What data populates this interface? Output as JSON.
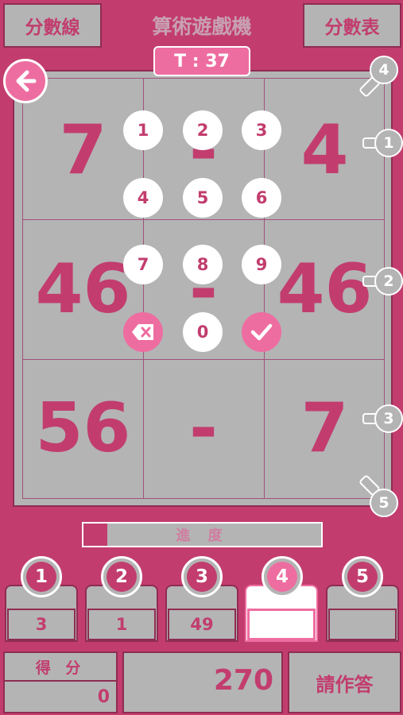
{
  "header": {
    "left_button": "分數線",
    "title": "算術遊戲機",
    "right_button": "分數表"
  },
  "timer": "T : 37",
  "grid": {
    "rows": [
      {
        "left": "7",
        "op": "-",
        "right": "4"
      },
      {
        "left": "46",
        "op": "-",
        "right": "46"
      },
      {
        "left": "56",
        "op": "-",
        "right": "7"
      }
    ]
  },
  "side_markers": [
    "4",
    "1",
    "2",
    "3",
    "5"
  ],
  "keypad": {
    "keys": [
      "1",
      "2",
      "3",
      "4",
      "5",
      "6",
      "7",
      "8",
      "9",
      "0"
    ],
    "delete_icon": "delete-icon",
    "confirm_icon": "check-icon"
  },
  "progress": {
    "label": "進 度",
    "fraction": 0.1
  },
  "answers": [
    {
      "index": "1",
      "value": "3"
    },
    {
      "index": "2",
      "value": "1"
    },
    {
      "index": "3",
      "value": "49"
    },
    {
      "index": "4",
      "value": ""
    },
    {
      "index": "5",
      "value": ""
    }
  ],
  "score": {
    "label": "得 分",
    "value": "0"
  },
  "total": "270",
  "answer_button": "請作答",
  "colors": {
    "primary": "#c23d6e",
    "accent": "#ee6da0",
    "panel": "#b4b4b4"
  }
}
